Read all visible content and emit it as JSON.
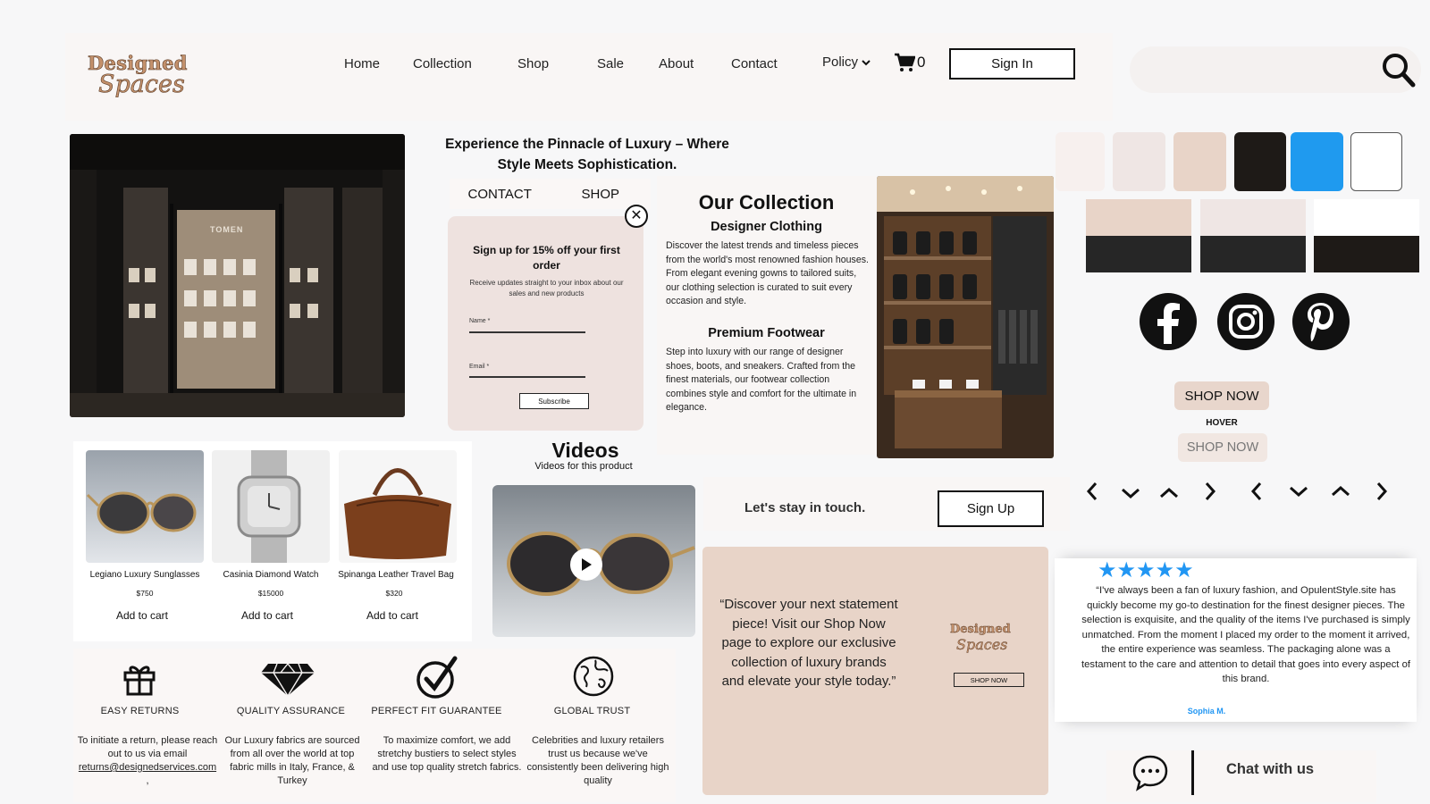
{
  "brand": {
    "line1": "Designed",
    "line2": "Spaces"
  },
  "nav": {
    "items": [
      "Home",
      "Collection",
      "Shop",
      "Sale",
      "About",
      "Contact"
    ],
    "policy": "Policy",
    "cart_count": "0",
    "signin": "Sign In"
  },
  "hero": {
    "tagline_line1": "Experience the Pinnacle of Luxury – Where",
    "tagline_line2": "Style Meets Sophistication.",
    "storefront_sign": "TOMEN",
    "tabs": [
      "CONTACT",
      "SHOP"
    ]
  },
  "popup": {
    "title": "Sign up for 15% off your first order",
    "subtitle": "Receive updates straight to your inbox about our sales and new products",
    "name_label": "Name *",
    "email_label": "Email *",
    "button": "Subscribe"
  },
  "collection": {
    "title": "Our Collection",
    "h1": "Designer Clothing",
    "p1": "Discover the latest trends and timeless pieces from the world's most renowned fashion houses. From elegant evening gowns to tailored suits, our clothing selection is curated to suit every occasion and style.",
    "h2": "Premium Footwear",
    "p2": "Step into luxury with our range of designer shoes, boots, and sneakers. Crafted from the finest materials, our footwear collection combines style and comfort for the ultimate in elegance."
  },
  "swatches": [
    "#f7f0ee",
    "#efe6e4",
    "#e8d4c8",
    "#1e1a17",
    "#1f9aef",
    "#ffffff"
  ],
  "swatch_bars": [
    {
      "top": "#e8d4c8",
      "bottom": "#262626"
    },
    {
      "top": "#efe6e4",
      "bottom": "#262626"
    },
    {
      "top": "#ffffff",
      "bottom": "#1e1a17"
    }
  ],
  "social": [
    "facebook",
    "instagram",
    "pinterest"
  ],
  "buttons": {
    "shop_now": "SHOP NOW",
    "hover_label": "HOVER",
    "shop_now_hover": "SHOP NOW"
  },
  "products": [
    {
      "name": "Legiano Luxury Sunglasses",
      "price": "$750",
      "add": "Add to cart"
    },
    {
      "name": "Casinia Diamond Watch",
      "price": "$15000",
      "add": "Add to cart"
    },
    {
      "name": "Spinanga Leather Travel Bag",
      "price": "$320",
      "add": "Add to cart"
    }
  ],
  "videos": {
    "title": "Videos",
    "subtitle": "Videos for this product"
  },
  "touch": {
    "label": "Let's stay in touch.",
    "button": "Sign Up"
  },
  "quote": {
    "text": "“Discover your next statement piece! Visit our Shop Now page to explore our exclusive collection of luxury brands and elevate your style today.”",
    "button": "SHOP NOW"
  },
  "review": {
    "stars": "★★★★★",
    "text": "“I've always been a fan of luxury fashion, and OpulentStyle.site has quickly become my go-to destination for the finest designer pieces. The selection is exquisite, and the quality of the items I've purchased is simply unmatched. From the moment I placed my order to the moment it arrived, the entire experience was seamless. The packaging alone was a testament to the care and attention to detail that goes into every aspect of this brand.",
    "author": "Sophia M."
  },
  "chat": {
    "label": "Chat with us"
  },
  "features": [
    {
      "title": "EASY RETURNS",
      "text": "To initiate a return, please reach out to us via email",
      "email": "returns@designedservices.com",
      "trail": ","
    },
    {
      "title": "QUALITY ASSURANCE",
      "text": "Our Luxury fabrics are sourced from all over the world at top fabric mills in Italy, France, & Turkey"
    },
    {
      "title": "PERFECT FIT GUARANTEE",
      "text": "To maximize comfort, we add stretchy bustiers to select styles and use top quality stretch fabrics."
    },
    {
      "title": "GLOBAL TRUST",
      "text": "Celebrities and luxury retailers trust us because we've consistently been delivering high quality"
    }
  ]
}
